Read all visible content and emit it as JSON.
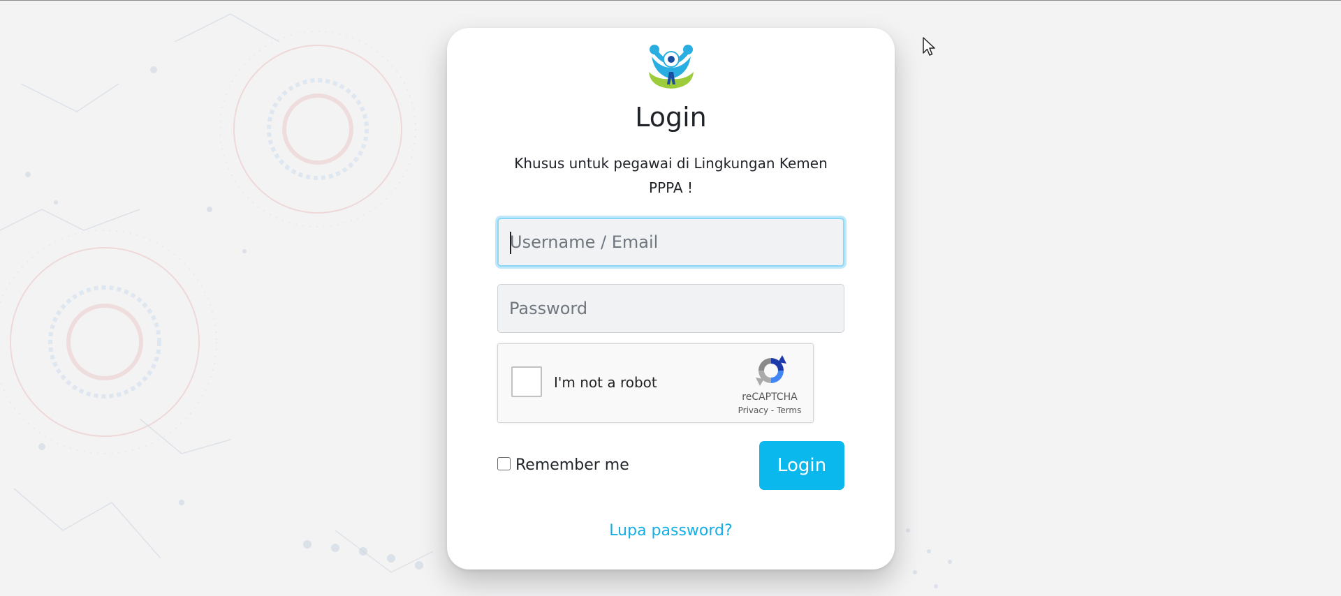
{
  "card": {
    "title": "Login",
    "subtitle": "Khusus untuk pegawai di Lingkungan Kemen PPPA !"
  },
  "form": {
    "username_placeholder": "Username / Email",
    "password_placeholder": "Password",
    "remember_label": "Remember me",
    "login_label": "Login",
    "forgot_label": "Lupa password?"
  },
  "recaptcha": {
    "label": "I'm not a robot",
    "brand": "reCAPTCHA",
    "links": "Privacy - Terms",
    "checked": false
  },
  "colors": {
    "accent": "#0bb8ee",
    "link": "#14aee6",
    "focus_ring": "#8cd6f6",
    "background": "#f3f3f4"
  },
  "icons": {
    "logo": "kemenpppa-logo",
    "captcha": "recaptcha-logo",
    "cursor": "mouse-pointer-icon"
  }
}
